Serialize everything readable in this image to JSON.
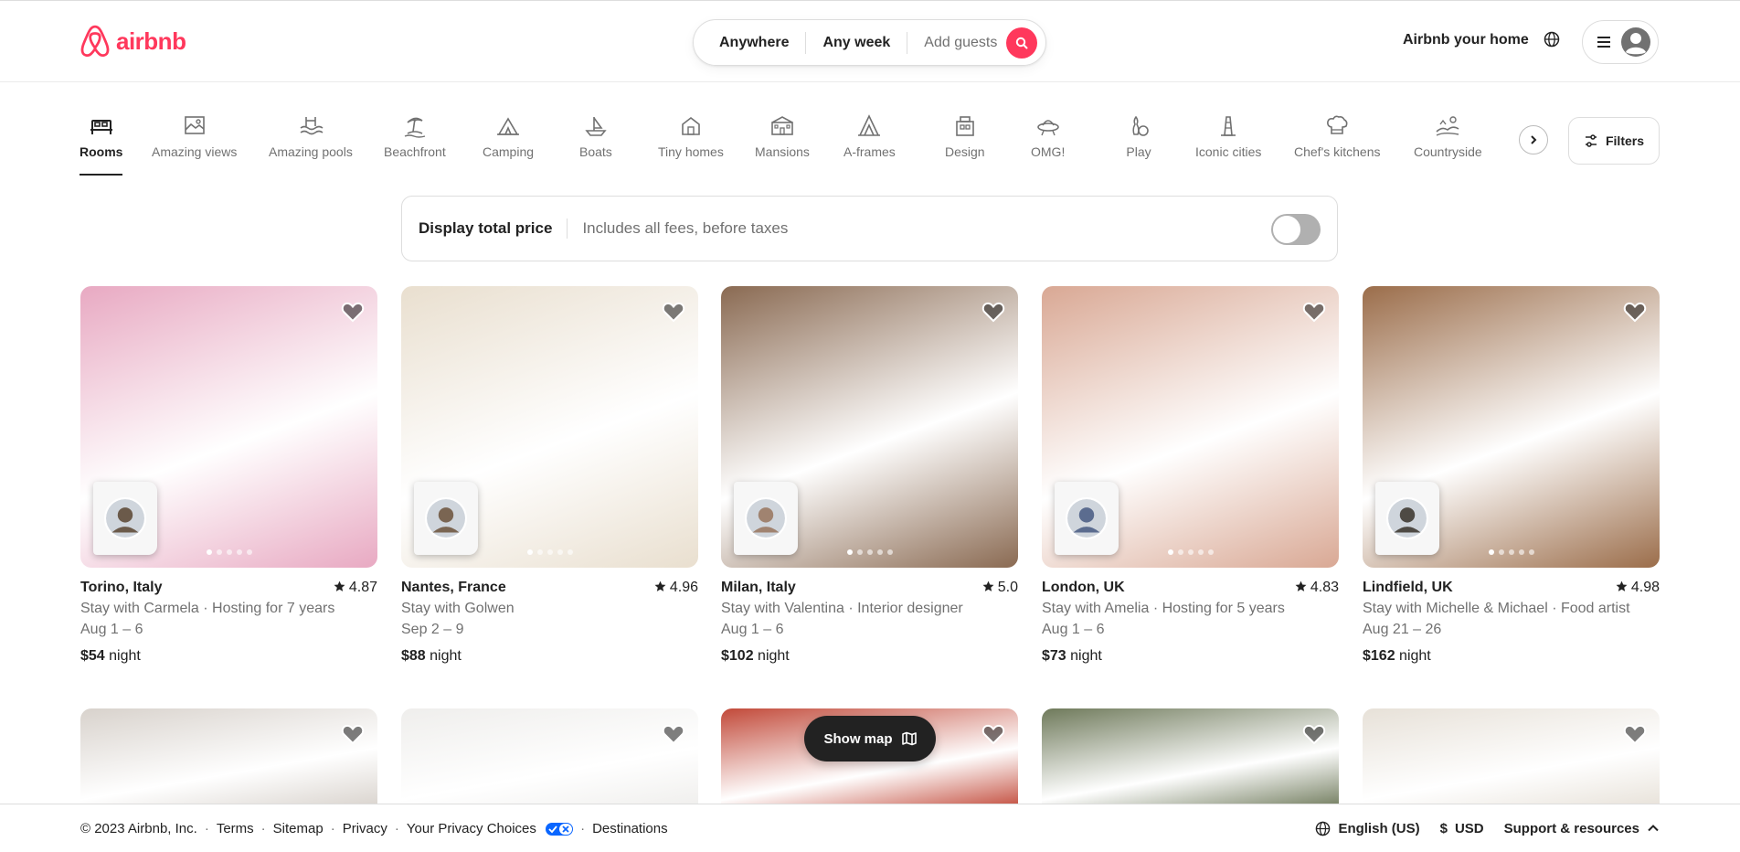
{
  "header": {
    "logo_text": "airbnb",
    "search": {
      "where": "Anywhere",
      "when": "Any week",
      "who": "Add guests"
    },
    "host_link": "Airbnb your home"
  },
  "categories": [
    {
      "label": "Rooms",
      "icon": "bed-icon",
      "active": true
    },
    {
      "label": "Amazing views",
      "icon": "picture-icon"
    },
    {
      "label": "Amazing pools",
      "icon": "pool-icon"
    },
    {
      "label": "Beachfront",
      "icon": "beach-icon"
    },
    {
      "label": "Camping",
      "icon": "tent-icon"
    },
    {
      "label": "Boats",
      "icon": "boat-icon"
    },
    {
      "label": "Tiny homes",
      "icon": "tiny-home-icon"
    },
    {
      "label": "Mansions",
      "icon": "mansion-icon"
    },
    {
      "label": "A-frames",
      "icon": "a-frame-icon"
    },
    {
      "label": "Design",
      "icon": "design-icon"
    },
    {
      "label": "OMG!",
      "icon": "ufo-icon"
    },
    {
      "label": "Play",
      "icon": "bowling-icon"
    },
    {
      "label": "Iconic cities",
      "icon": "tower-icon"
    },
    {
      "label": "Chef's kitchens",
      "icon": "chef-hat-icon"
    },
    {
      "label": "Countryside",
      "icon": "countryside-icon"
    }
  ],
  "filters_label": "Filters",
  "total_price": {
    "title": "Display total price",
    "subtitle": "Includes all fees, before taxes",
    "enabled": false
  },
  "listings": [
    {
      "location": "Torino, Italy",
      "rating": "4.87",
      "host_line": "Stay with Carmela · Hosting for 7 years",
      "dates": "Aug 1 – 6",
      "price": "$54",
      "price_unit": "night",
      "color": "#e8a9c2"
    },
    {
      "location": "Nantes, France",
      "rating": "4.96",
      "host_line": "Stay with Golwen",
      "dates": "Sep 2 – 9",
      "price": "$88",
      "price_unit": "night",
      "color": "#e9dfcf"
    },
    {
      "location": "Milan, Italy",
      "rating": "5.0",
      "host_line": "Stay with Valentina · Interior designer",
      "dates": "Aug 1 – 6",
      "price": "$102",
      "price_unit": "night",
      "color": "#8a6a52"
    },
    {
      "location": "London, UK",
      "rating": "4.83",
      "host_line": "Stay with Amelia · Hosting for 5 years",
      "dates": "Aug 1 – 6",
      "price": "$73",
      "price_unit": "night",
      "color": "#d9a894"
    },
    {
      "location": "Lindfield, UK",
      "rating": "4.98",
      "host_line": "Stay with Michelle & Michael · Food artist",
      "dates": "Aug 21 – 26",
      "price": "$162",
      "price_unit": "night",
      "color": "#9b6d4a"
    }
  ],
  "second_row_colors": [
    "#d8d2cc",
    "#efeeec",
    "#c24a3a",
    "#6f7a5b",
    "#e7e1d8"
  ],
  "show_map_label": "Show map",
  "footer": {
    "copyright": "© 2023 Airbnb, Inc.",
    "links": [
      "Terms",
      "Sitemap",
      "Privacy",
      "Your Privacy Choices",
      "Destinations"
    ],
    "language": "English (US)",
    "currency_symbol": "$",
    "currency": "USD",
    "support": "Support & resources"
  }
}
